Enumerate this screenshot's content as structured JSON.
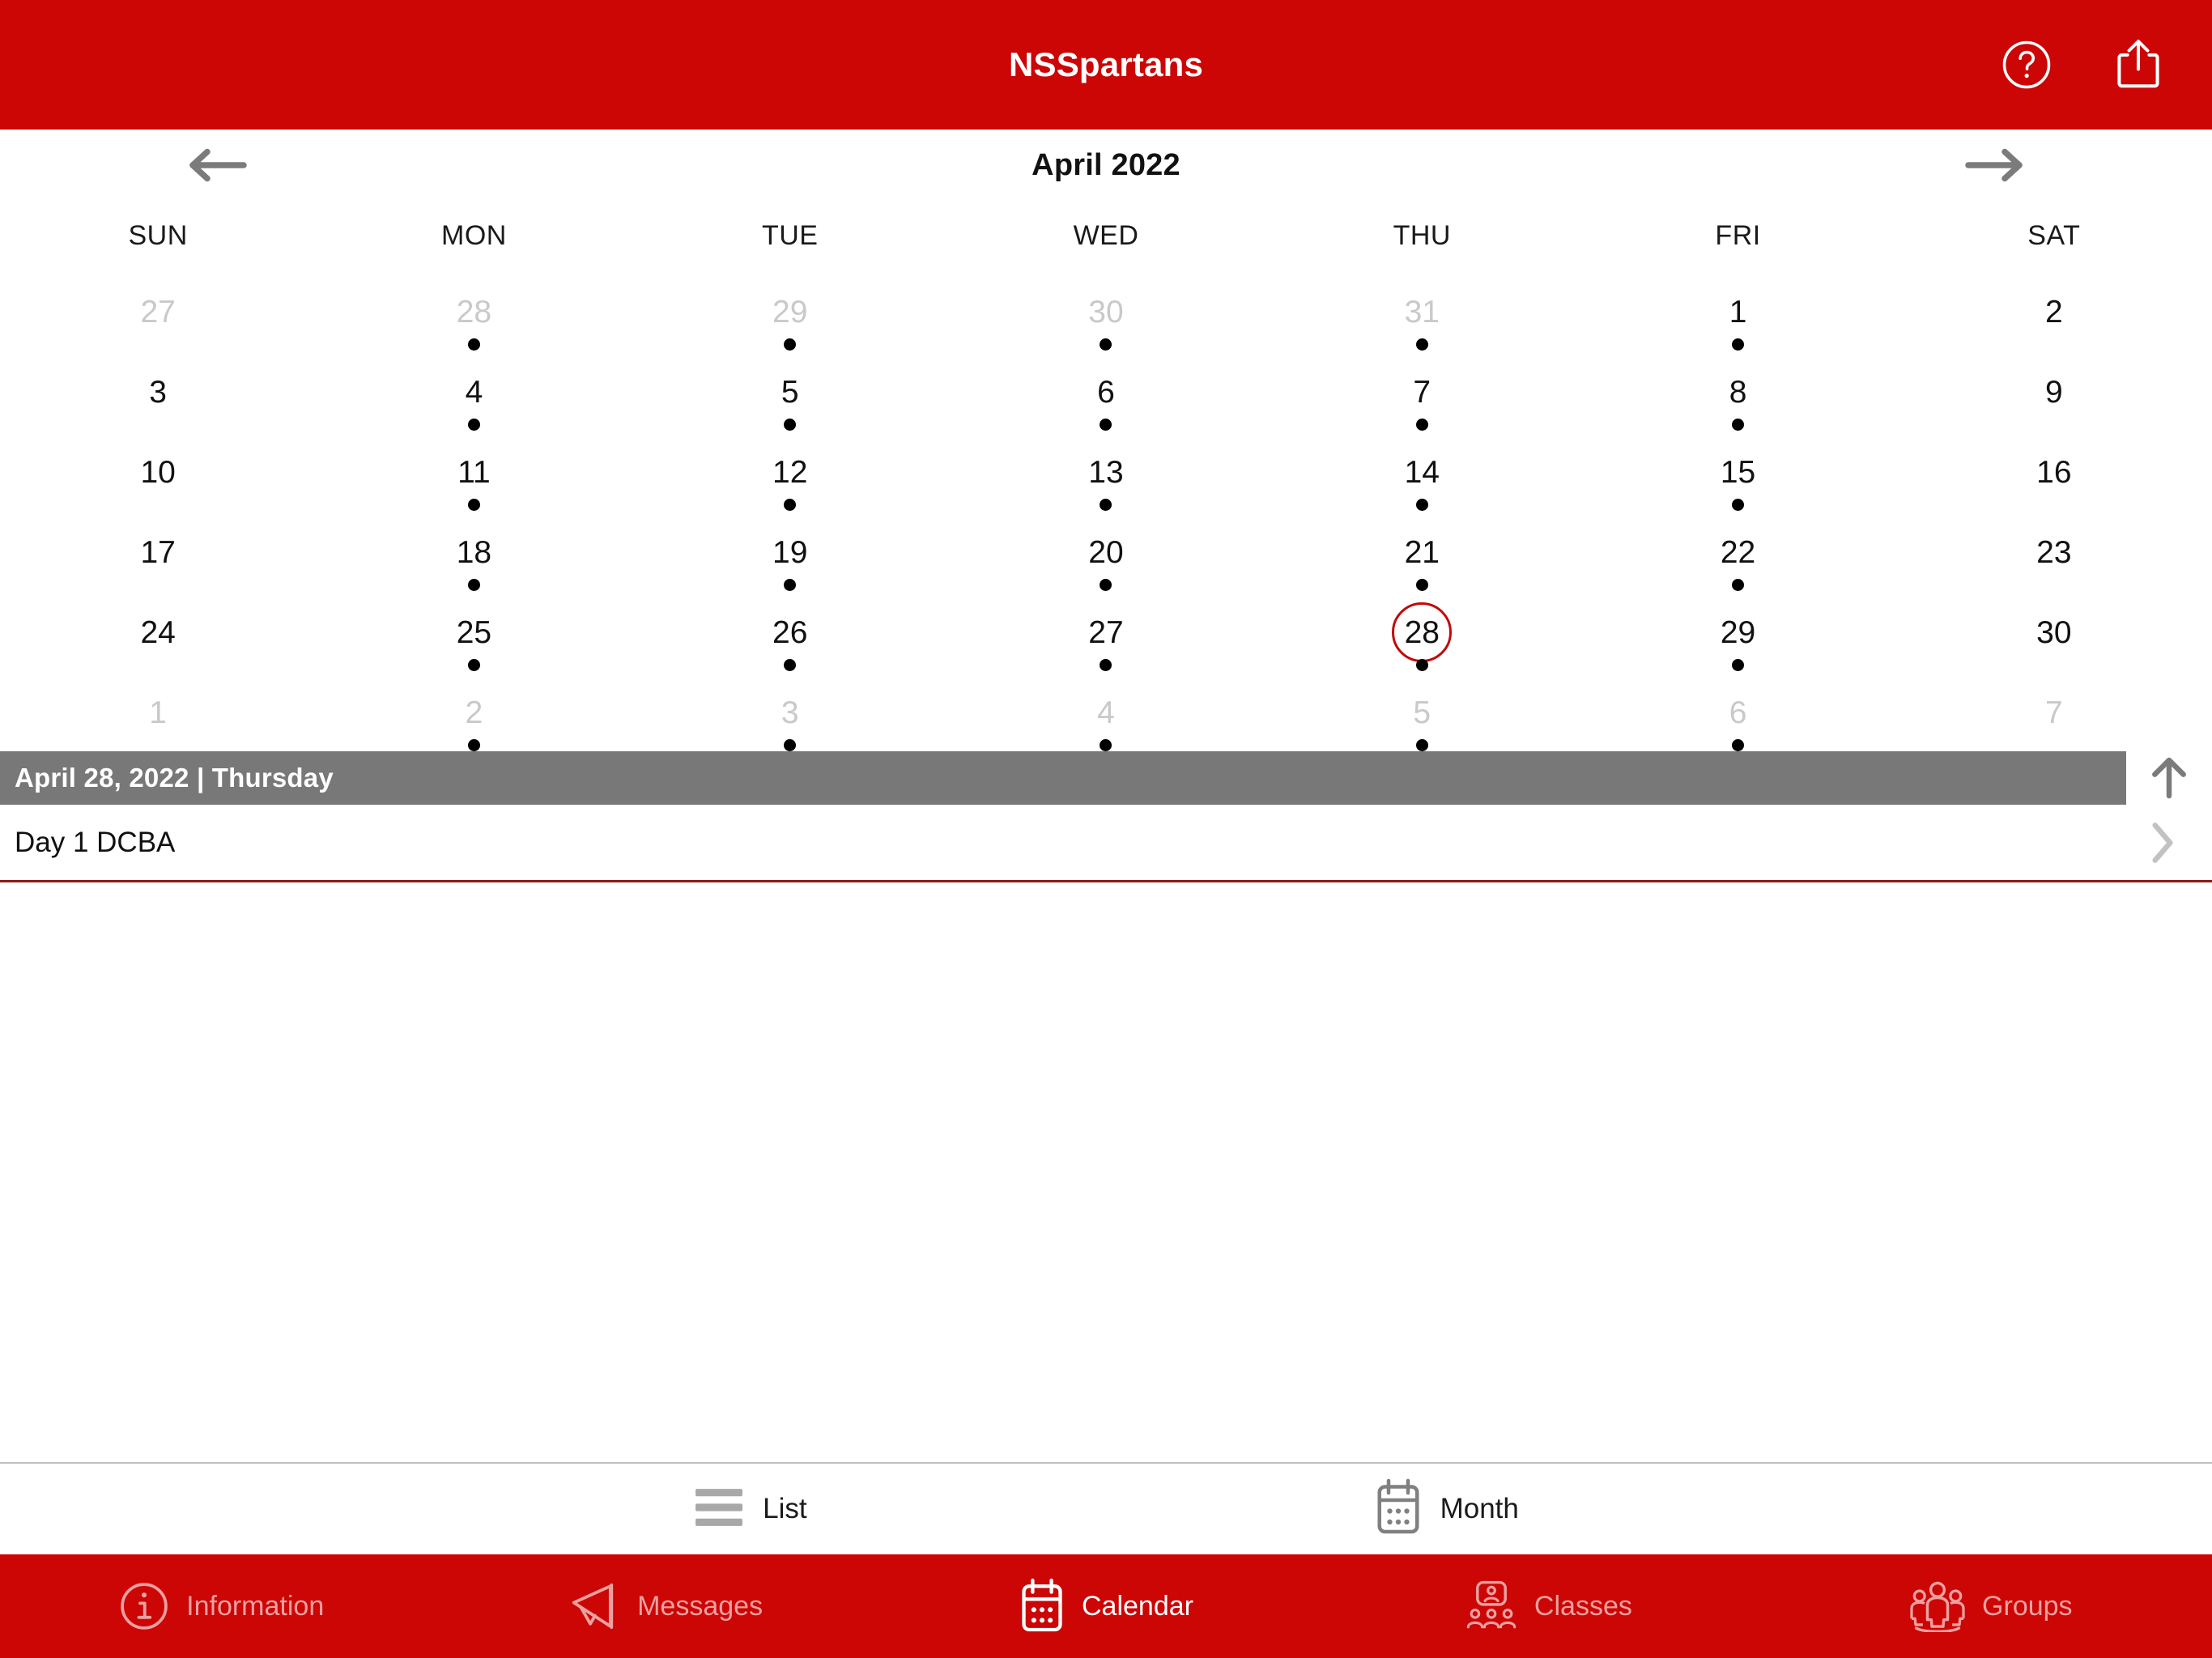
{
  "topbar": {
    "title": "NSSpartans",
    "help_icon": "question-circle-icon",
    "share_icon": "share-upload-icon"
  },
  "calendar": {
    "month_title": "April 2022",
    "prev_label": "previous-month",
    "next_label": "next-month",
    "weekdays": [
      "SUN",
      "MON",
      "TUE",
      "WED",
      "THU",
      "FRI",
      "SAT"
    ],
    "cells": [
      {
        "day": "27",
        "muted": true,
        "dot": false,
        "selected": false
      },
      {
        "day": "28",
        "muted": true,
        "dot": true,
        "selected": false
      },
      {
        "day": "29",
        "muted": true,
        "dot": true,
        "selected": false
      },
      {
        "day": "30",
        "muted": true,
        "dot": true,
        "selected": false
      },
      {
        "day": "31",
        "muted": true,
        "dot": true,
        "selected": false
      },
      {
        "day": "1",
        "muted": false,
        "dot": true,
        "selected": false
      },
      {
        "day": "2",
        "muted": false,
        "dot": false,
        "selected": false
      },
      {
        "day": "3",
        "muted": false,
        "dot": false,
        "selected": false
      },
      {
        "day": "4",
        "muted": false,
        "dot": true,
        "selected": false
      },
      {
        "day": "5",
        "muted": false,
        "dot": true,
        "selected": false
      },
      {
        "day": "6",
        "muted": false,
        "dot": true,
        "selected": false
      },
      {
        "day": "7",
        "muted": false,
        "dot": true,
        "selected": false
      },
      {
        "day": "8",
        "muted": false,
        "dot": true,
        "selected": false
      },
      {
        "day": "9",
        "muted": false,
        "dot": false,
        "selected": false
      },
      {
        "day": "10",
        "muted": false,
        "dot": false,
        "selected": false
      },
      {
        "day": "11",
        "muted": false,
        "dot": true,
        "selected": false
      },
      {
        "day": "12",
        "muted": false,
        "dot": true,
        "selected": false
      },
      {
        "day": "13",
        "muted": false,
        "dot": true,
        "selected": false
      },
      {
        "day": "14",
        "muted": false,
        "dot": true,
        "selected": false
      },
      {
        "day": "15",
        "muted": false,
        "dot": true,
        "selected": false
      },
      {
        "day": "16",
        "muted": false,
        "dot": false,
        "selected": false
      },
      {
        "day": "17",
        "muted": false,
        "dot": false,
        "selected": false
      },
      {
        "day": "18",
        "muted": false,
        "dot": true,
        "selected": false
      },
      {
        "day": "19",
        "muted": false,
        "dot": true,
        "selected": false
      },
      {
        "day": "20",
        "muted": false,
        "dot": true,
        "selected": false
      },
      {
        "day": "21",
        "muted": false,
        "dot": true,
        "selected": false
      },
      {
        "day": "22",
        "muted": false,
        "dot": true,
        "selected": false
      },
      {
        "day": "23",
        "muted": false,
        "dot": false,
        "selected": false
      },
      {
        "day": "24",
        "muted": false,
        "dot": false,
        "selected": false
      },
      {
        "day": "25",
        "muted": false,
        "dot": true,
        "selected": false
      },
      {
        "day": "26",
        "muted": false,
        "dot": true,
        "selected": false
      },
      {
        "day": "27",
        "muted": false,
        "dot": true,
        "selected": false
      },
      {
        "day": "28",
        "muted": false,
        "dot": true,
        "selected": true
      },
      {
        "day": "29",
        "muted": false,
        "dot": true,
        "selected": false
      },
      {
        "day": "30",
        "muted": false,
        "dot": false,
        "selected": false
      },
      {
        "day": "1",
        "muted": true,
        "dot": false,
        "selected": false
      },
      {
        "day": "2",
        "muted": true,
        "dot": true,
        "selected": false
      },
      {
        "day": "3",
        "muted": true,
        "dot": true,
        "selected": false
      },
      {
        "day": "4",
        "muted": true,
        "dot": true,
        "selected": false
      },
      {
        "day": "5",
        "muted": true,
        "dot": true,
        "selected": false
      },
      {
        "day": "6",
        "muted": true,
        "dot": true,
        "selected": false
      },
      {
        "day": "7",
        "muted": true,
        "dot": false,
        "selected": false
      }
    ]
  },
  "selected_day": {
    "header": "April 28, 2022 | Thursday",
    "collapse_icon": "arrow-up-icon",
    "events": [
      {
        "title": "Day 1 DCBA",
        "chevron": "chevron-right-icon"
      }
    ]
  },
  "view_switch": {
    "items": [
      {
        "label": "List",
        "icon": "list-lines-icon",
        "active": false
      },
      {
        "label": "Month",
        "icon": "calendar-icon",
        "active": true
      }
    ]
  },
  "tabbar": {
    "tabs": [
      {
        "label": "Information",
        "icon": "info-circle-icon",
        "active": false
      },
      {
        "label": "Messages",
        "icon": "megaphone-icon",
        "active": false
      },
      {
        "label": "Calendar",
        "icon": "calendar-icon",
        "active": true
      },
      {
        "label": "Classes",
        "icon": "classes-icon",
        "active": false
      },
      {
        "label": "Groups",
        "icon": "groups-icon",
        "active": false
      }
    ]
  },
  "colors": {
    "brand_red": "#CC0505",
    "selected_ring": "#C00A0A",
    "daybar_gray": "#787878",
    "event_divider": "#8B1A1A",
    "muted_text": "#c9c9c9"
  }
}
